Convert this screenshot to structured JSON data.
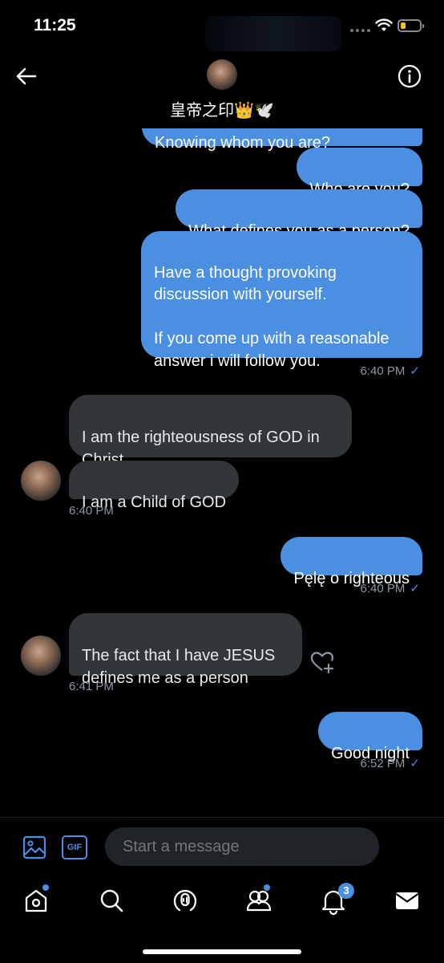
{
  "status_bar": {
    "time": "11:25"
  },
  "header": {
    "contact_name": "皇帝之印👑🕊️"
  },
  "messages": [
    {
      "partial_text": "Knowing whom you are?"
    },
    {
      "text": "Who are you?"
    },
    {
      "text": "What defines you as a person?"
    },
    {
      "text": "Have a thought provoking\ndiscussion with yourself.\n\nIf you come up with a reasonable\nanswer i will follow you."
    },
    {
      "meta": "6:40 PM"
    },
    {
      "text": "I am the righteousness of GOD in\nChrist"
    },
    {
      "text": "I am a Child of GOD"
    },
    {
      "meta": "6:40 PM"
    },
    {
      "text": "Pęlę o righteous"
    },
    {
      "meta": "6:40 PM"
    },
    {
      "text": "The fact that I have JESUS\ndefines me as a person"
    },
    {
      "meta": "6:41 PM"
    },
    {
      "text": "Good night"
    },
    {
      "meta": "6:52 PM"
    }
  ],
  "composer": {
    "placeholder": "Start a message",
    "gif_label": "GIF"
  },
  "tabbar": {
    "notifications_count": "3"
  },
  "colors": {
    "accent": "#4a8fe2",
    "incoming_bubble": "#333639",
    "background": "#000000"
  },
  "icons": [
    "back-arrow-icon",
    "info-icon",
    "media-icon",
    "gif-icon",
    "voice-icon",
    "home-icon",
    "search-icon",
    "spaces-icon",
    "communities-icon",
    "bell-icon",
    "mail-icon",
    "heart-plus-icon"
  ]
}
